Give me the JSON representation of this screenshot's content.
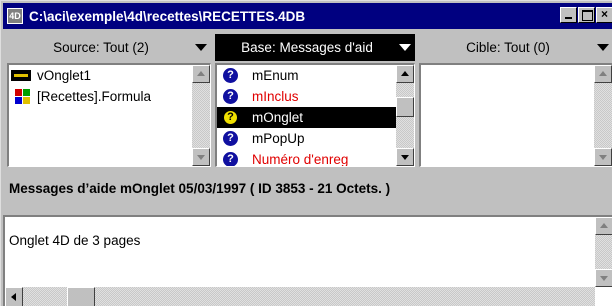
{
  "window": {
    "title": "C:\\aci\\exemple\\4d\\recettes\\RECETTES.4DB",
    "app_icon": "4D",
    "buttons": {
      "minimize": "minimize-icon",
      "maximize": "maximize-icon",
      "close": "×"
    }
  },
  "columns": {
    "source": {
      "label": "Source: Tout (2)"
    },
    "base": {
      "label": "Base: Messages d'aid"
    },
    "cible": {
      "label": "Cible: Tout (0)"
    }
  },
  "source_list": [
    {
      "icon": "variable-icon",
      "label": "vOnglet1"
    },
    {
      "icon": "form-icon",
      "label": "[Recettes].Formula"
    }
  ],
  "base_list": [
    {
      "icon": "help-icon",
      "label": "mEnum",
      "red": false,
      "selected": false
    },
    {
      "icon": "help-icon",
      "label": "mInclus",
      "red": true,
      "selected": false
    },
    {
      "icon": "help-icon",
      "label": "mOnglet",
      "red": false,
      "selected": true
    },
    {
      "icon": "help-icon",
      "label": "mPopUp",
      "red": false,
      "selected": false
    },
    {
      "icon": "help-icon",
      "label": "Numéro d'enreg",
      "red": true,
      "selected": false
    }
  ],
  "status": {
    "text": "Messages d’aide mOnglet  05/03/1997 (  ID 3853 - 21 Octets. )"
  },
  "comment": {
    "text": "Onglet 4D de 3 pages"
  },
  "colors": {
    "titlebar": "#000080",
    "selection": "#000000",
    "red_item": "#e00000",
    "help_icon": "#1010a0"
  }
}
